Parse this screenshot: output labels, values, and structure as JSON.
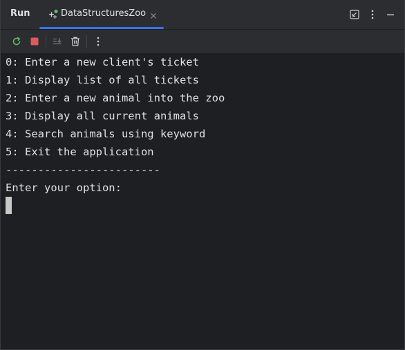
{
  "panel": {
    "title": "Run"
  },
  "tab": {
    "label": "DataStructuresZoo",
    "icon": "run-config-icon",
    "status_color": "#5fb865"
  },
  "header_actions": [
    {
      "name": "restore-layout-icon"
    },
    {
      "name": "more-options-icon"
    },
    {
      "name": "minimize-icon"
    }
  ],
  "toolbar": [
    {
      "name": "rerun-icon"
    },
    {
      "name": "stop-icon"
    },
    {
      "name": "scroll-to-end-icon"
    },
    {
      "name": "clear-all-icon"
    },
    {
      "name": "more-options-icon"
    }
  ],
  "console": {
    "lines": [
      "0: Enter a new client's ticket",
      "1: Display list of all tickets",
      "2: Enter a new animal into the zoo",
      "3: Display all current animals",
      "4: Search animals using keyword",
      "5: Exit the application",
      "------------------------",
      "Enter your option:"
    ],
    "input_value": ""
  },
  "colors": {
    "accent": "#3574f0",
    "background": "#1e1f22",
    "toolbar_bg": "#2b2d30",
    "stop_red": "#db5c5c",
    "rerun_green": "#5fb865"
  }
}
